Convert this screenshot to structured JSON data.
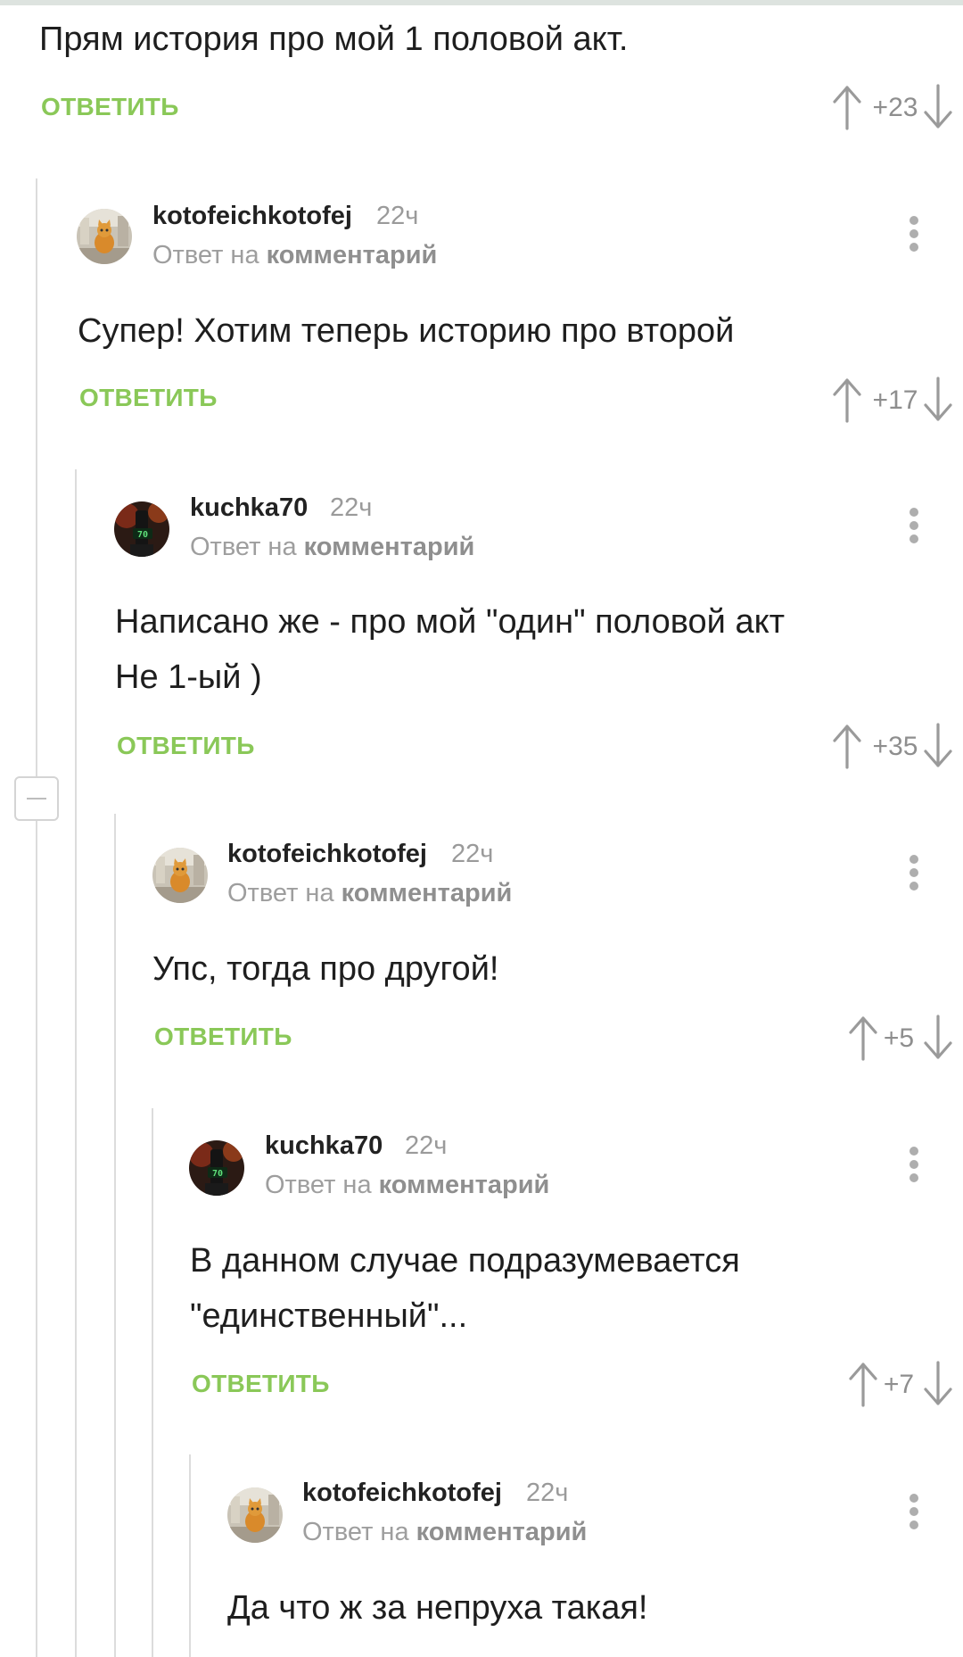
{
  "top_comment": {
    "text": "Прям история про мой 1 половой акт.",
    "reply_label": "ОТВЕТИТЬ",
    "score": "+23"
  },
  "comments": [
    {
      "author": "kotofeichkotofej",
      "time": "22ч",
      "reply_prefix": "Ответ на",
      "reply_link": "комментарий",
      "lines": [
        "Супер! Хотим теперь историю про второй"
      ],
      "reply_label": "ОТВЕТИТЬ",
      "score": "+17",
      "avatar_icon": "cat-avatar"
    },
    {
      "author": "kuchka70",
      "time": "22ч",
      "reply_prefix": "Ответ на",
      "reply_link": "комментарий",
      "lines": [
        "Написано же - про мой \"один\" половой акт",
        "Не 1-ый )"
      ],
      "reply_label": "ОТВЕТИТЬ",
      "score": "+35",
      "avatar_icon": "dark-avatar-70"
    },
    {
      "author": "kotofeichkotofej",
      "time": "22ч",
      "reply_prefix": "Ответ на",
      "reply_link": "комментарий",
      "lines": [
        "Упс, тогда про другой!"
      ],
      "reply_label": "ОТВЕТИТЬ",
      "score": "+5",
      "avatar_icon": "cat-avatar"
    },
    {
      "author": "kuchka70",
      "time": "22ч",
      "reply_prefix": "Ответ на",
      "reply_link": "комментарий",
      "lines": [
        "В данном случае подразумевается",
        "\"единственный\"..."
      ],
      "reply_label": "ОТВЕТИТЬ",
      "score": "+7",
      "avatar_icon": "dark-avatar-70"
    },
    {
      "author": "kotofeichkotofej",
      "time": "22ч",
      "reply_prefix": "Ответ на",
      "reply_link": "комментарий",
      "lines": [
        "Да что ж за непруха такая!"
      ],
      "avatar_icon": "cat-avatar"
    }
  ],
  "colors": {
    "accent_green": "#8ac858",
    "muted_gray": "#9e9e9e",
    "thread_line": "#dcdcdc"
  }
}
